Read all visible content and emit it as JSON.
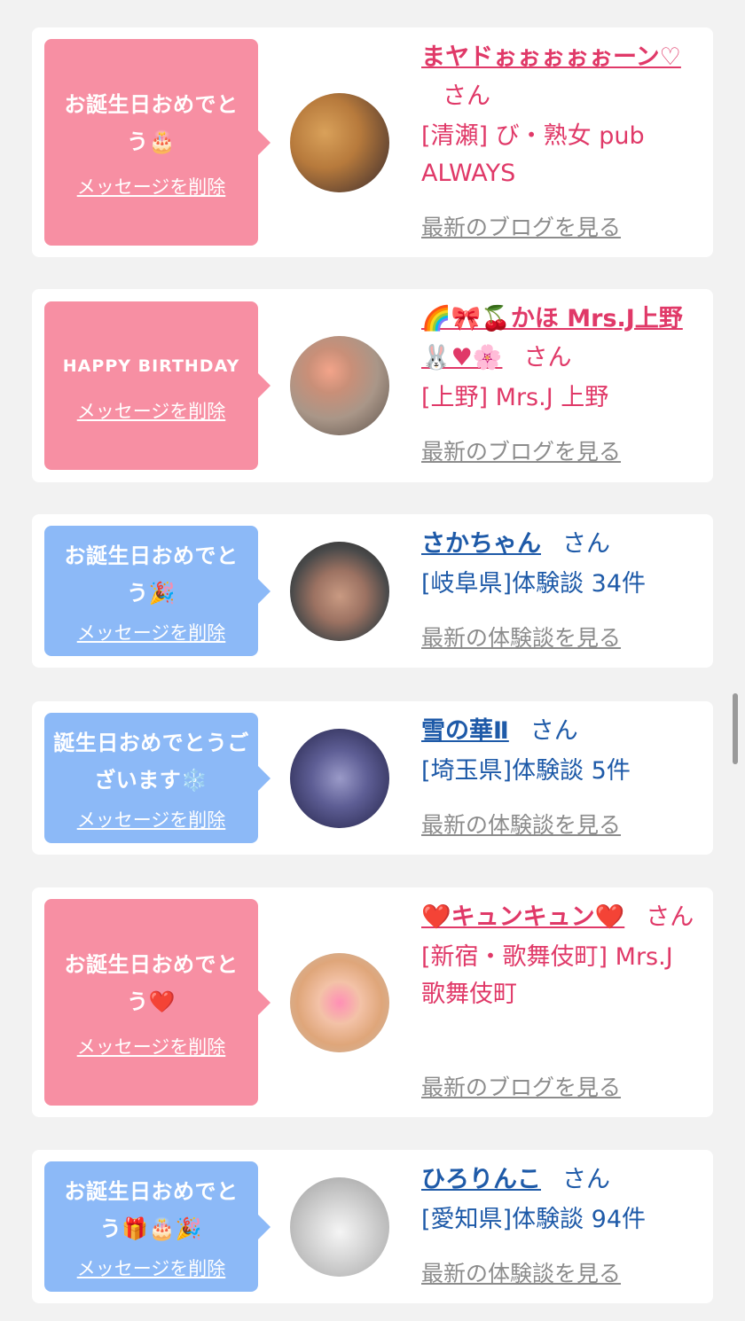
{
  "cards": [
    {
      "message": "お誕生日おめでとう🎂",
      "delete_label": "メッセージを削除",
      "name": "まヤドぉぉぉぉぉーン♡",
      "honorific": "さん",
      "shop": "[清瀬] び・熟女 pub ALWAYS",
      "latest": "最新のブログを見る",
      "bubble_color": "#f78fa3"
    },
    {
      "message": "HAPPY BIRTHDAY",
      "delete_label": "メッセージを削除",
      "name": "🌈🎀🍒かほ Mrs.J上野🐰♥🌸",
      "honorific": "さん",
      "shop": "[上野] Mrs.J 上野",
      "latest": "最新のブログを見る",
      "bubble_color": "#f78fa3"
    },
    {
      "message": "お誕生日おめでとう🎉",
      "delete_label": "メッセージを削除",
      "name": "さかちゃん",
      "honorific": "さん",
      "shop": "[岐阜県]体験談 34件",
      "latest": "最新の体験談を見る",
      "bubble_color": "#8cb9f7"
    },
    {
      "message": "誕生日おめでとうございます❄️",
      "delete_label": "メッセージを削除",
      "name": "雪の華Ⅱ",
      "honorific": "さん",
      "shop": "[埼玉県]体験談 5件",
      "latest": "最新の体験談を見る",
      "bubble_color": "#8cb9f7"
    },
    {
      "message": "お誕生日おめでとう❤️",
      "delete_label": "メッセージを削除",
      "name": "❤️キュンキュン❤️",
      "honorific": "さん",
      "shop": "[新宿・歌舞伎町] Mrs.J 歌舞伎町",
      "latest": "最新のブログを見る",
      "bubble_color": "#f78fa3"
    },
    {
      "message": "お誕生日おめでとう🎁🎂🎉",
      "delete_label": "メッセージを削除",
      "name": "ひろりんこ",
      "honorific": "さん",
      "shop": "[愛知県]体験談 94件",
      "latest": "最新の体験談を見る",
      "bubble_color": "#8cb9f7"
    }
  ]
}
